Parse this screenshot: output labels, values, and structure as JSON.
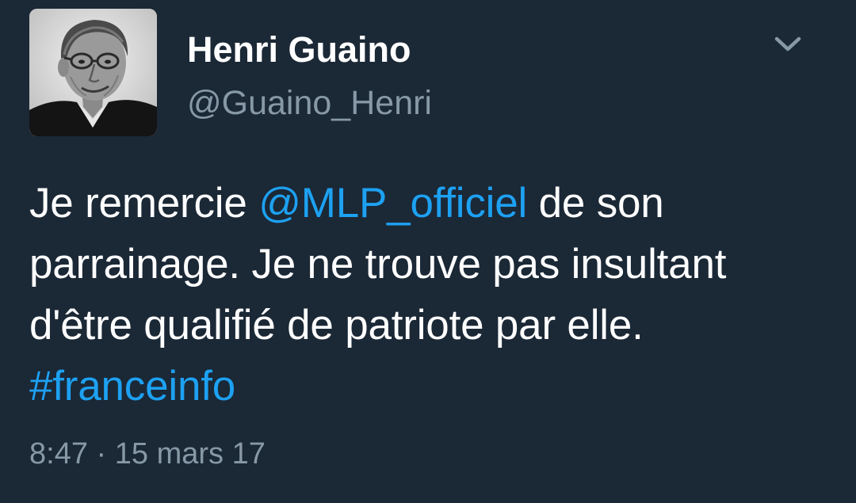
{
  "tweet": {
    "display_name": "Henri Guaino",
    "handle": "@Guaino_Henri",
    "text_part1": "Je remercie ",
    "mention": "@MLP_officiel",
    "text_part2": " de son parrainage. Je ne trouve pas insultant d'être qualifié de patriote par elle. ",
    "hashtag": "#franceinfo",
    "time": "8:47",
    "separator": " · ",
    "date": "15 mars 17",
    "menu_icon": "chevron-down-icon"
  },
  "colors": {
    "background": "#1b2836",
    "text": "#ffffff",
    "secondary": "#8899a6",
    "link": "#1da1f2"
  }
}
